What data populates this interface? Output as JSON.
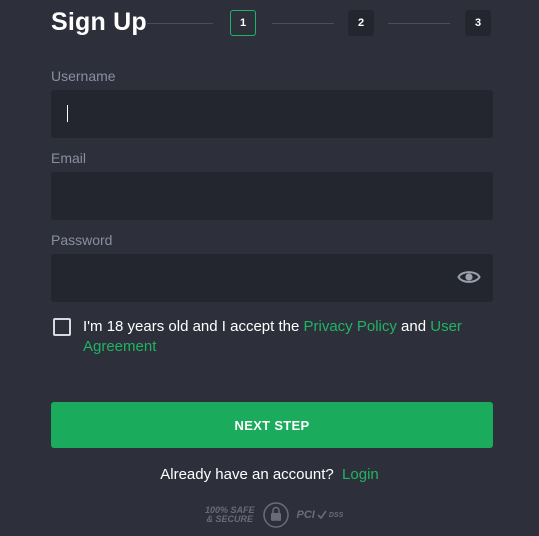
{
  "header": {
    "title": "Sign Up",
    "steps": [
      "1",
      "2",
      "3"
    ],
    "active_step": "1"
  },
  "form": {
    "username_label": "Username",
    "email_label": "Email",
    "password_label": "Password",
    "username_value": "",
    "email_value": "",
    "password_value": "",
    "password_toggle_icon": "eye-icon"
  },
  "agreement": {
    "text_before": "I'm 18 years old and I accept the ",
    "privacy_link": "Privacy Policy",
    "text_middle": " and ",
    "user_agreement_link": "User Agreement",
    "checked": false
  },
  "actions": {
    "next_label": "NEXT STEP",
    "login_prompt": "Already have an account?",
    "login_link": "Login"
  },
  "badges": {
    "safe_line1": "100% SAFE",
    "safe_line2": "& SECURE",
    "ssl": "SSL",
    "pci": "PCI",
    "dss": "DSS"
  },
  "colors": {
    "background": "#2d303b",
    "input": "#23262f",
    "accent": "#1aac5c",
    "label": "#8a8fa0"
  }
}
